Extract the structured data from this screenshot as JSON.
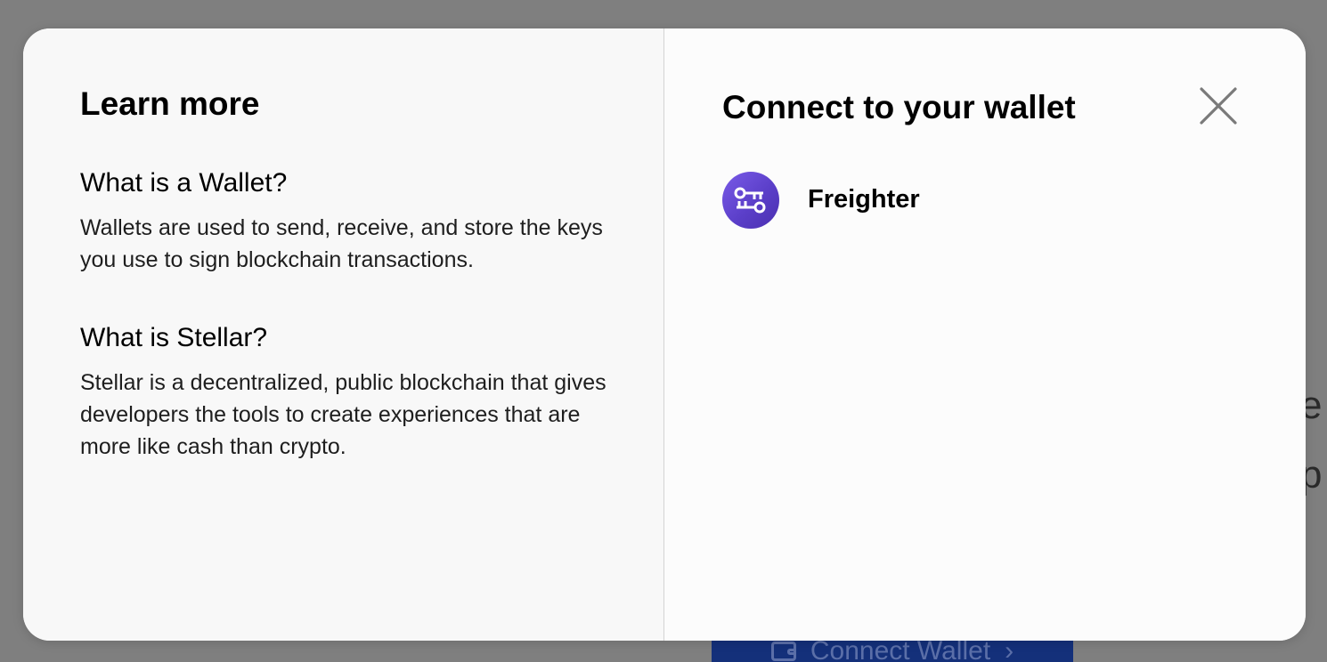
{
  "background": {
    "text_fragment_1": "e",
    "text_fragment_2": "p",
    "connect_button_label": "Connect Wallet",
    "connect_button_chevron": "›"
  },
  "learn_more": {
    "title": "Learn more",
    "sections": [
      {
        "question": "What is a Wallet?",
        "answer": "Wallets are used to send, receive, and store the keys you use to sign blockchain transactions."
      },
      {
        "question": "What is Stellar?",
        "answer": "Stellar is a decentralized, public blockchain that gives developers the tools to create experiences that are more like cash than crypto."
      }
    ]
  },
  "connect": {
    "title": "Connect to your wallet",
    "close_icon": "close-icon",
    "wallets": [
      {
        "name": "Freighter",
        "icon": "freighter-key-icon"
      }
    ]
  },
  "colors": {
    "freighter_brand": "#5b3fc9",
    "overlay": "#7f7f7f"
  }
}
